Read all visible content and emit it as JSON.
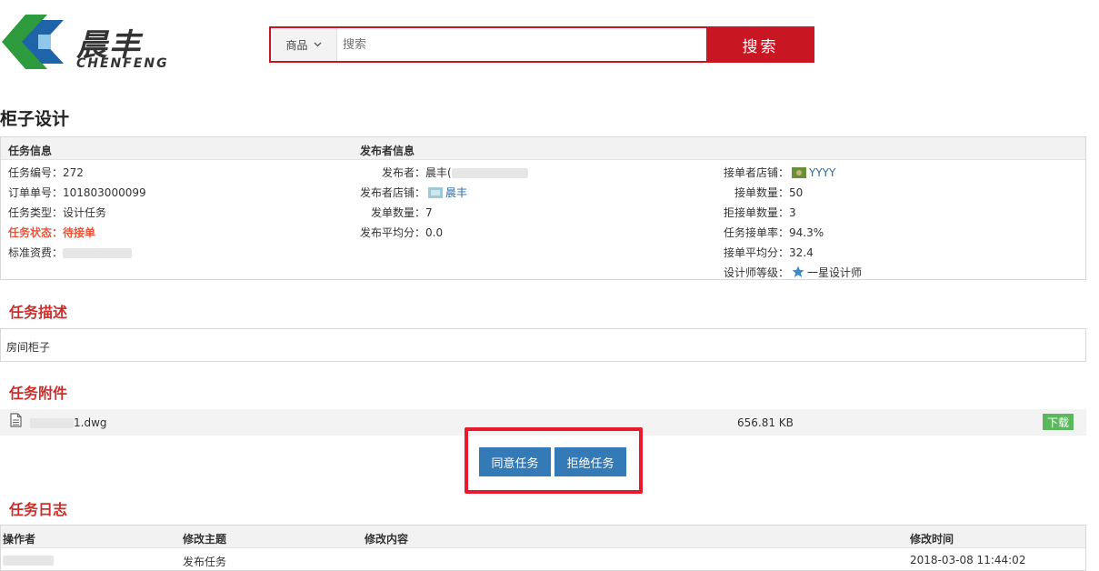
{
  "header": {
    "brand_cn": "晨丰",
    "brand_en": "CHENFENG",
    "search": {
      "category": "商品",
      "placeholder": "搜索",
      "button": "搜索"
    }
  },
  "page_title": "柜子设计",
  "task_info": {
    "heading": "任务信息",
    "id": "任务编号：272",
    "order": "订单单号：101803000099",
    "type": "任务类型：设计任务",
    "status": "任务状态：待接单",
    "fee_label": "标准资费："
  },
  "publisher_info": {
    "heading": "发布者信息",
    "publisher_label": "发布者：",
    "publisher_name": "晨丰(",
    "shop_label": "发布者店铺：",
    "shop_name": "晨丰",
    "orders": "发单数量：7",
    "avg": "发布平均分：0.0"
  },
  "taker_info": {
    "shop_label": "接单者店铺：",
    "shop_name": "YYYY",
    "accepted": "接单数量：50",
    "rejected": "拒接单数量：3",
    "rate": "任务接单率：94.3%",
    "avg": "接单平均分：32.4",
    "level_label": "设计师等级：",
    "level": "一星设计师"
  },
  "description": {
    "heading": "任务描述",
    "text": "房间柜子"
  },
  "attachments": {
    "heading": "任务附件",
    "file_suffix": "1.dwg",
    "size": "656.81 KB",
    "download": "下载"
  },
  "actions": {
    "accept": "同意任务",
    "reject": "拒绝任务"
  },
  "log": {
    "heading": "任务日志",
    "columns": [
      "操作者",
      "修改主题",
      "修改内容",
      "修改时间"
    ],
    "rows": [
      {
        "subject": "发布任务",
        "time": "2018-03-08 11:44:02"
      }
    ]
  },
  "colors": {
    "brand_red": "#c81623",
    "section_red": "#c9302c",
    "button_blue": "#337ab7",
    "download_green": "#5cb85c"
  }
}
